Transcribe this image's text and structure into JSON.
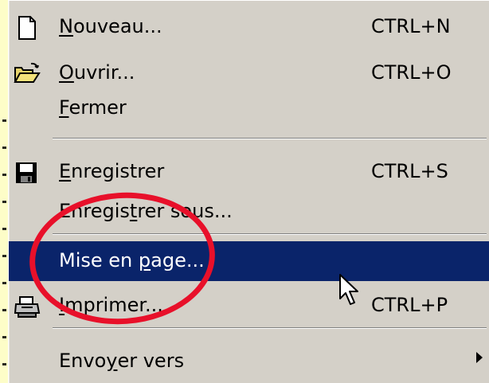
{
  "menu": {
    "items": [
      {
        "label_pre": "",
        "label_mn": "N",
        "label_post": "ouveau...",
        "shortcut": "CTRL+N",
        "icon": "new-document-icon"
      },
      {
        "label_pre": "",
        "label_mn": "O",
        "label_post": "uvrir...",
        "shortcut": "CTRL+O",
        "icon": "open-folder-icon"
      },
      {
        "label_pre": "",
        "label_mn": "F",
        "label_post": "ermer",
        "shortcut": "",
        "icon": ""
      },
      {
        "label_pre": "",
        "label_mn": "E",
        "label_post": "nregistrer",
        "shortcut": "CTRL+S",
        "icon": "save-disk-icon"
      },
      {
        "label_pre": "Enregis",
        "label_mn": "t",
        "label_post": "rer sous...",
        "shortcut": "",
        "icon": ""
      },
      {
        "label_pre": "Mise en ",
        "label_mn": "p",
        "label_post": "age...",
        "shortcut": "",
        "icon": ""
      },
      {
        "label_pre": "",
        "label_mn": "I",
        "label_post": "mprimer...",
        "shortcut": "CTRL+P",
        "icon": "printer-icon"
      },
      {
        "label_pre": "Envo",
        "label_mn": "y",
        "label_post": "er vers",
        "shortcut": "",
        "icon": "submenu-arrow-icon"
      }
    ],
    "highlighted_index": 5
  },
  "colors": {
    "menu_bg": "#d4d0c8",
    "highlight_bg": "#0a246a",
    "annotation_red": "#e8102a",
    "page_bg": "#fdfdc8"
  }
}
